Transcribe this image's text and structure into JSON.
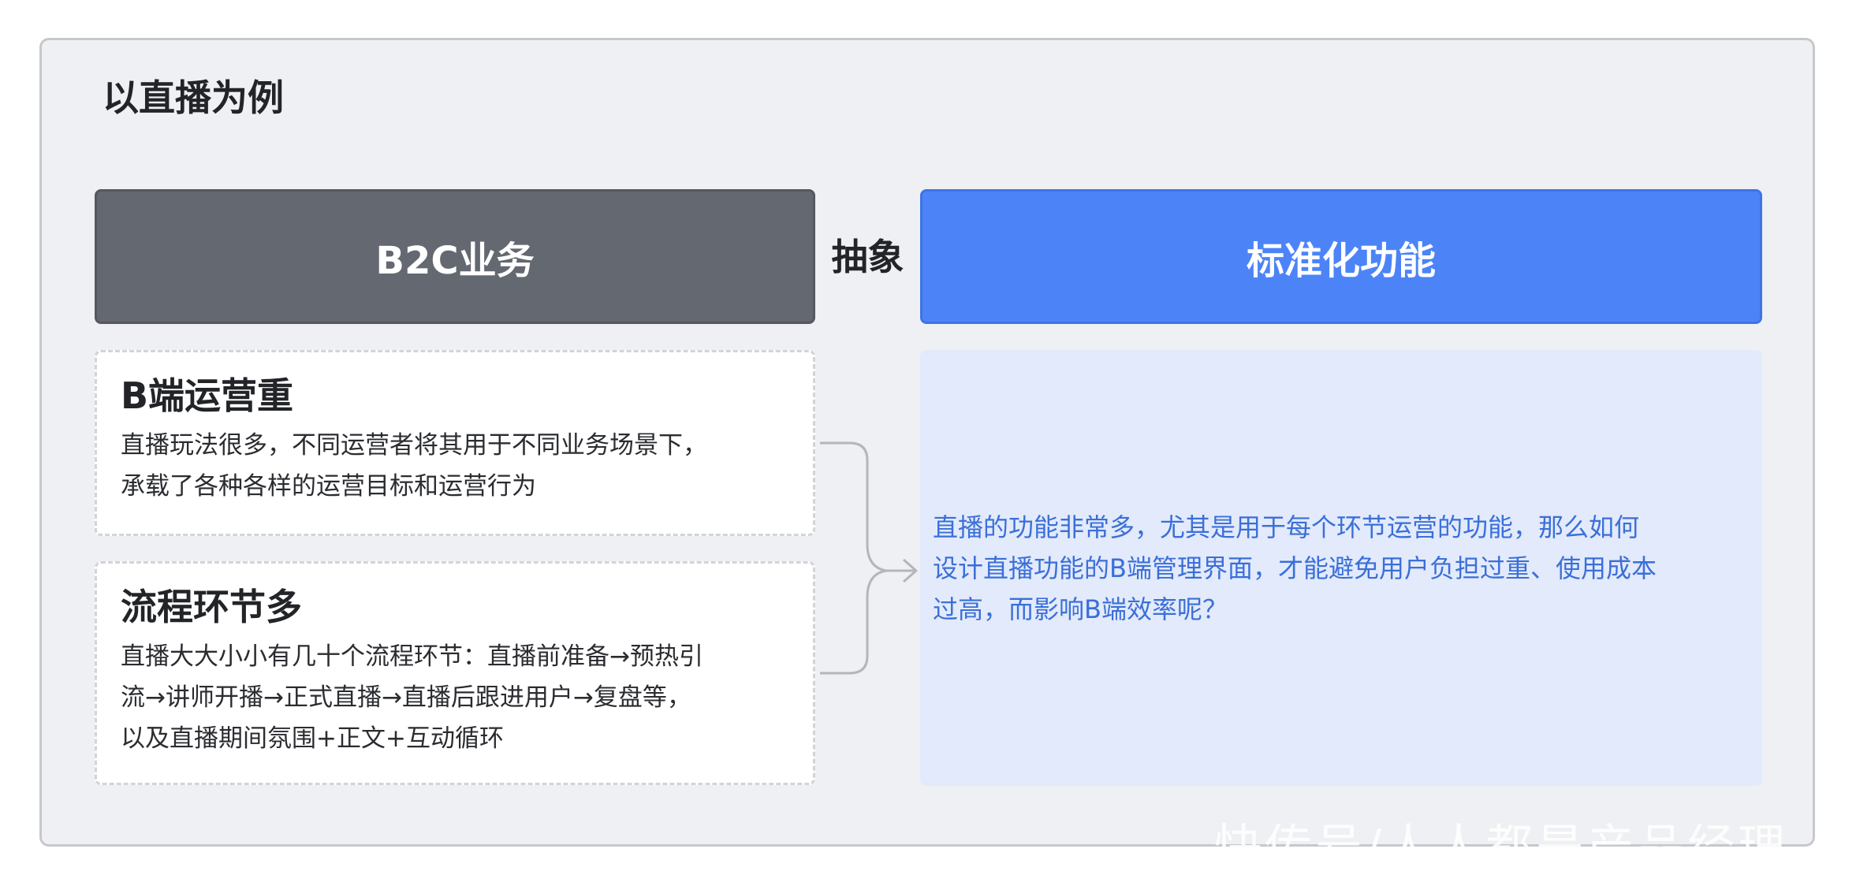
{
  "title": "以直播为例",
  "left_header": "B2C业务",
  "abstract_label": "抽象",
  "right_header": "标准化功能",
  "cards": [
    {
      "title": "B端运营重",
      "lines": [
        "直播玩法很多，不同运营者将其用于不同业务场景下，",
        "承载了各种各样的运营目标和运营行为"
      ]
    },
    {
      "title": "流程环节多",
      "lines": [
        "直播大大小小有几十个流程环节：直播前准备→预热引",
        "流→讲师开播→正式直播→直播后跟进用户→复盘等，",
        "以及直播期间氛围+正文+互动循环"
      ]
    }
  ],
  "result": {
    "lines": [
      "直播的功能非常多，尤其是用于每个环节运营的功能，那么如何",
      "设计直播功能的B端管理界面，才能避免用户负担过重、使用成本",
      "过高，而影响B端效率呢？"
    ]
  },
  "watermark": "快传号/人人都是产品经理",
  "colors": {
    "left_header_bg": "#646870",
    "right_header_bg": "#4c84f8",
    "result_bg": "#e2eafb",
    "result_text": "#3b6fd8",
    "connector": "#b3b6bb"
  }
}
